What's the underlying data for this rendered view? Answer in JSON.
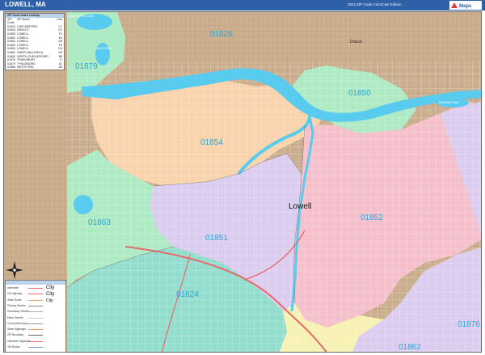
{
  "header": {
    "title": "LOWELL, MA",
    "edition": "2022 ZIP Code ColorCast Edition",
    "logo_text": "Market Maps"
  },
  "map": {
    "zip_labels": [
      {
        "code": "01826",
        "color": "#2aa7d6"
      },
      {
        "code": "01879",
        "color": "#2aa7d6"
      },
      {
        "code": "01850",
        "color": "#2aa7d6"
      },
      {
        "code": "01854",
        "color": "#2aa7d6"
      },
      {
        "code": "01852",
        "color": "#2aa7d6"
      },
      {
        "code": "01851",
        "color": "#2aa7d6"
      },
      {
        "code": "01863",
        "color": "#2aa7d6"
      },
      {
        "code": "01824",
        "color": "#2aa7d6"
      },
      {
        "code": "01862",
        "color": "#2aa7d6"
      },
      {
        "code": "01876",
        "color": "#2aa7d6"
      }
    ],
    "city_label": "Lowell",
    "place_labels": {
      "dracut": "Dracut",
      "lake1": "MASCUPPIC LAKE",
      "lake2": "LONG POND",
      "lake3": "MARTINS POND"
    },
    "colors": {
      "tan": "#cdb08f",
      "green": "#aeeac4",
      "orange": "#f8d3ac",
      "pink": "#f5c0cc",
      "lavender": "#dccdf0",
      "teal": "#93ddcf",
      "water": "#58cbef",
      "yellow": "#f7f1b3",
      "highway": "#e66b6b"
    }
  },
  "zip_table": {
    "headers": [
      "ZIP Code",
      "ZIP Name",
      "Grid"
    ],
    "title": "ZIP Code Index Lookup",
    "rows": [
      [
        "01824",
        "CHELMSFORD",
        "C7"
      ],
      [
        "01826",
        "DRACUT",
        "D2"
      ],
      [
        "01850",
        "LOWELL",
        "F2"
      ],
      [
        "01851",
        "LOWELL",
        "E5"
      ],
      [
        "01852",
        "LOWELL",
        "G5"
      ],
      [
        "01853",
        "LOWELL",
        "F4"
      ],
      [
        "01854",
        "LOWELL",
        "D3"
      ],
      [
        "01862",
        "NORTH BILLERICA",
        "H8"
      ],
      [
        "01863",
        "NORTH CHELMSFORD",
        "B5"
      ],
      [
        "01876",
        "TEWKSBURY",
        "I7"
      ],
      [
        "01879",
        "TYNGSBORO",
        "A2"
      ],
      [
        "01886",
        "WESTFORD",
        "A6"
      ]
    ]
  },
  "legend": {
    "rows": [
      "Interstate",
      "US Highway",
      "State Route",
      "Primary Streets",
      "Secondary Streets",
      "Minor Streets",
      "County Boundary",
      "State Highways",
      "ZIP Boundary",
      "Interstate Highways",
      "Toll Roads"
    ],
    "city_samples": [
      "City",
      "City",
      "City"
    ]
  }
}
